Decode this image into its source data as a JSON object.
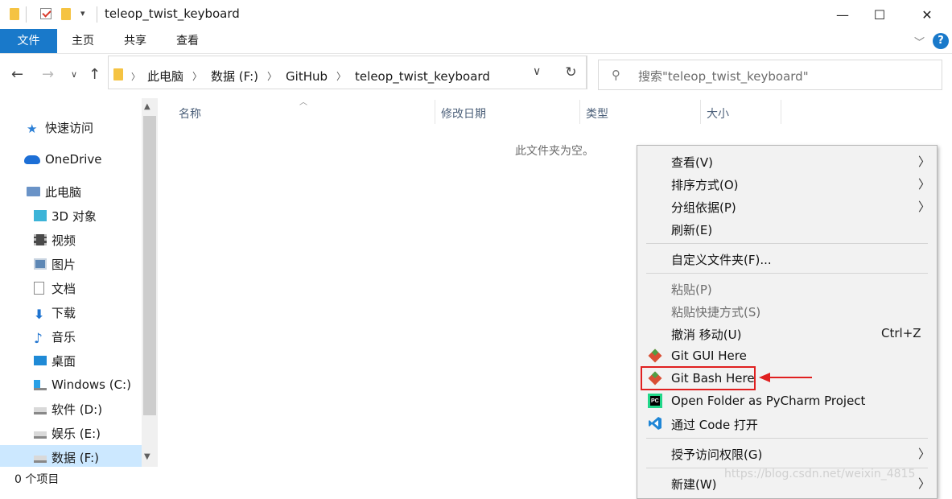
{
  "window": {
    "title": "teleop_twist_keyboard"
  },
  "title_controls": {
    "minimize": "—",
    "maximize": "☐",
    "close": "✕"
  },
  "ribbon": {
    "tabs": [
      "文件",
      "主页",
      "共享",
      "查看"
    ],
    "help": "?"
  },
  "address": {
    "crumbs": [
      "此电脑",
      "数据 (F:)",
      "GitHub",
      "teleop_twist_keyboard"
    ]
  },
  "search": {
    "placeholder": "搜索\"teleop_twist_keyboard\""
  },
  "sidebar": {
    "items": [
      {
        "label": "快速访问",
        "icon": "star-icon"
      },
      {
        "label": "OneDrive",
        "icon": "cloud-icon"
      },
      {
        "label": "此电脑",
        "icon": "computer-icon"
      },
      {
        "label": "3D 对象",
        "icon": "cube-icon"
      },
      {
        "label": "视频",
        "icon": "film-icon"
      },
      {
        "label": "图片",
        "icon": "picture-icon"
      },
      {
        "label": "文档",
        "icon": "document-icon"
      },
      {
        "label": "下载",
        "icon": "download-icon"
      },
      {
        "label": "音乐",
        "icon": "music-icon"
      },
      {
        "label": "桌面",
        "icon": "desktop-icon"
      },
      {
        "label": "Windows (C:)",
        "icon": "windows-drive-icon"
      },
      {
        "label": "软件 (D:)",
        "icon": "drive-icon"
      },
      {
        "label": "娱乐 (E:)",
        "icon": "drive-icon"
      },
      {
        "label": "数据 (F:)",
        "icon": "drive-icon"
      }
    ]
  },
  "columns": [
    "名称",
    "修改日期",
    "类型",
    "大小"
  ],
  "content": {
    "empty_message": "此文件夹为空。"
  },
  "status": {
    "item_count": "0 个项目"
  },
  "context_menu": {
    "items": [
      {
        "label": "查看(V)",
        "submenu": true
      },
      {
        "label": "排序方式(O)",
        "submenu": true
      },
      {
        "label": "分组依据(P)",
        "submenu": true
      },
      {
        "label": "刷新(E)"
      },
      {
        "label": "自定义文件夹(F)..."
      },
      {
        "label": "粘贴(P)",
        "disabled": true
      },
      {
        "label": "粘贴快捷方式(S)",
        "disabled": true
      },
      {
        "label": "撤消 移动(U)",
        "shortcut": "Ctrl+Z"
      },
      {
        "label": "Git GUI Here",
        "icon": "git-icon"
      },
      {
        "label": "Git Bash Here",
        "icon": "git-icon",
        "highlighted": true
      },
      {
        "label": "Open Folder as PyCharm Project",
        "icon": "pycharm-icon"
      },
      {
        "label": "通过 Code 打开",
        "icon": "vscode-icon"
      },
      {
        "label": "授予访问权限(G)",
        "submenu": true
      },
      {
        "label": "新建(W)",
        "submenu": true
      }
    ]
  },
  "watermark": "https://blog.csdn.net/weixin_4815"
}
